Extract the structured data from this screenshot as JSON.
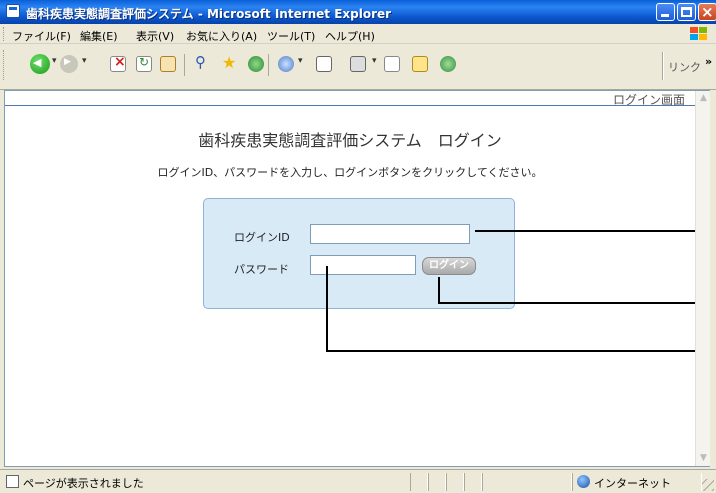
{
  "window": {
    "title": "歯科疾患実態調査評価システム - Microsoft Internet Explorer"
  },
  "menubar": {
    "items": [
      "ファイル(F)",
      "編集(E)",
      "表示(V)",
      "お気に入り(A)",
      "ツール(T)",
      "ヘルプ(H)"
    ]
  },
  "toolbar": {
    "links_label": "リンク",
    "more_label": "»"
  },
  "page": {
    "label": "ログイン画面",
    "title": "歯科疾患実態調査評価システム　ログイン",
    "instructions": "ログインID、パスワードを入力し、ログインボタンをクリックしてください。",
    "login_id_label": "ログインID",
    "password_label": "パスワード",
    "login_id_value": "",
    "password_value": "",
    "login_button_label": "ログイン"
  },
  "statusbar": {
    "text": "ページが表示されました",
    "zone": "インターネット"
  }
}
